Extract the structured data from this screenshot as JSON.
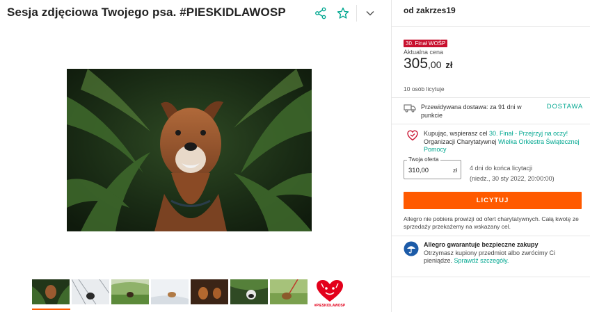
{
  "header": {
    "title": "Sesja zdjęciowa Twojego psa. #PIESKIDLAWOSP",
    "share_icon": "share-icon",
    "favorite_icon": "star-icon",
    "expand_icon": "chevron-down-icon"
  },
  "gallery": {
    "active_index": 0,
    "thumbnails": [
      "dog-in-ferns",
      "dog-in-snow",
      "dog-in-grass-field",
      "dog-in-snow-2",
      "dog-autumn",
      "dog-forest",
      "dog-with-leash"
    ],
    "wosp_thumb_caption": "#PIESKIDLAWOSP"
  },
  "seller": {
    "label": "od zakrzes19"
  },
  "offer": {
    "badge": "30. Finał WOŚP",
    "price_label": "Aktualna cena",
    "price_main": "305",
    "price_decimal": ",00",
    "price_currency": "zł",
    "bidders": "10 osób licytuje",
    "delivery_text": "Przewidywana dostawa: za 91 dni w punkcie",
    "delivery_link": "DOSTAWA",
    "charity_prefix": "Kupując, wspierasz cel ",
    "charity_goal": "30. Finał - Przejrzyj na oczy!",
    "charity_org_prefix": "Organizacji Charytatywnej ",
    "charity_org": "Wielka Orkiestra Świątecznej Pomocy",
    "bid_label": "Twoja oferta",
    "bid_value": "310,00",
    "bid_currency": "zł",
    "time_left": "4 dni do końca licytacji",
    "end_date": "(niedz., 30 sty 2022, 20:00:00)",
    "bid_button": "LICYTUJ",
    "note": "Allegro nie pobiera prowizji od ofert charytatywnych. Całą kwotę ze sprzedaży przekażemy na wskazany cel."
  },
  "guarantee": {
    "title": "Allegro gwarantuje bezpieczne zakupy",
    "text": "Otrzymasz kupiony przedmiot albo zwrócimy Ci pieniądze. ",
    "link": "Sprawdź szczegóły."
  },
  "colors": {
    "accent": "#ff5a00",
    "link_green": "#00a790",
    "badge_red": "#c8102e",
    "wosp_red": "#e3001b"
  }
}
